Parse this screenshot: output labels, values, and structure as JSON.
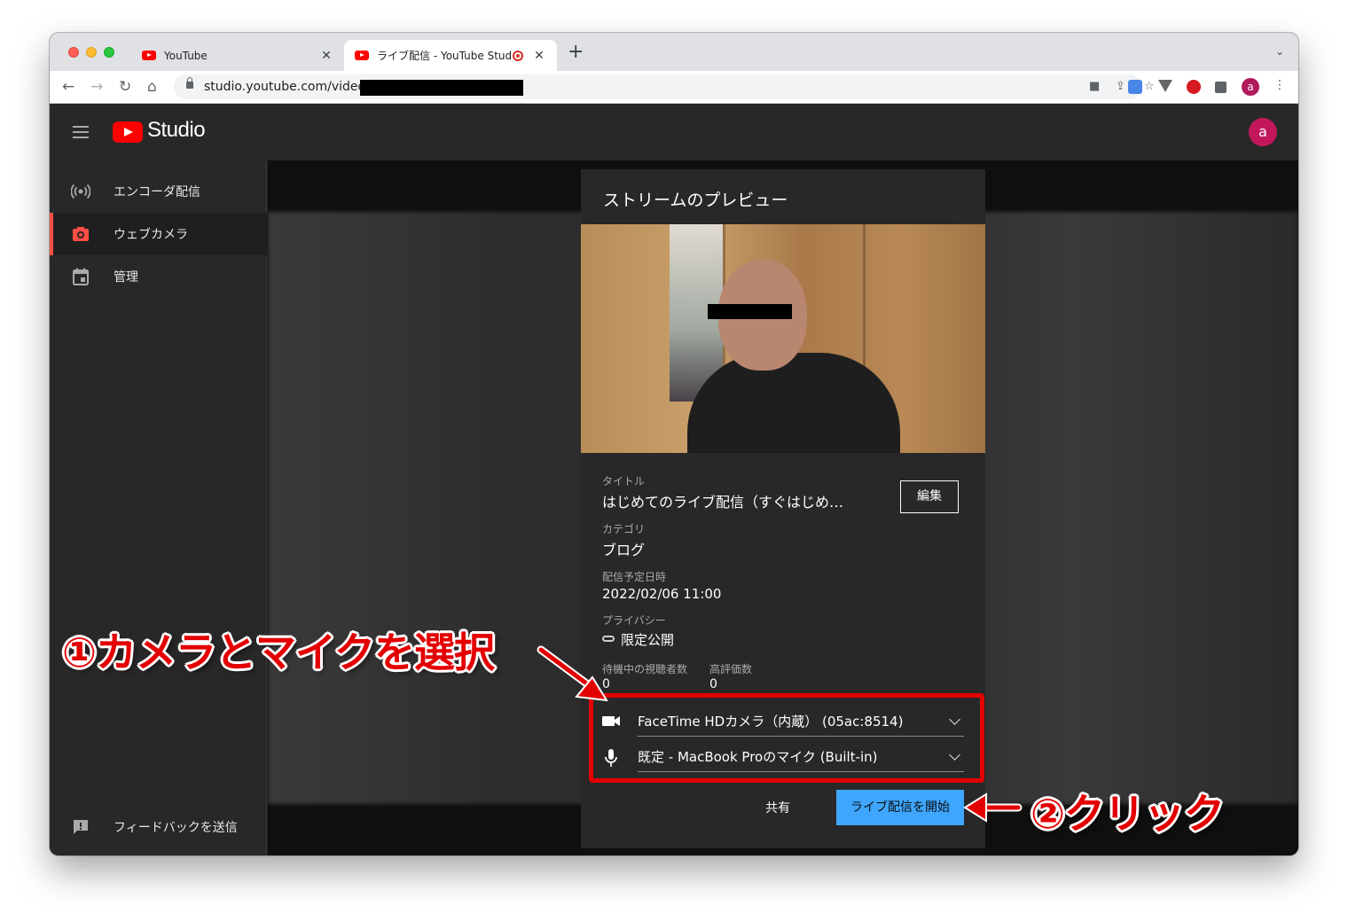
{
  "browser": {
    "tabs": [
      {
        "title": "YouTube",
        "active": false
      },
      {
        "title": "ライブ配信 - YouTube Studio",
        "active": true
      }
    ],
    "url": "studio.youtube.com/video/"
  },
  "studio": {
    "logo_text": "Studio",
    "avatar_letter": "a",
    "sidebar": {
      "items": [
        {
          "label": "エンコーダ配信",
          "icon": "broadcast-icon"
        },
        {
          "label": "ウェブカメラ",
          "icon": "camera-icon",
          "active": true
        },
        {
          "label": "管理",
          "icon": "calendar-icon"
        }
      ],
      "feedback_label": "フィードバックを送信"
    }
  },
  "dialog": {
    "title": "ストリームのプレビュー",
    "title_label": "タイトル",
    "title_value": "はじめてのライブ配信（すぐはじめ…",
    "edit_button": "編集",
    "category_label": "カテゴリ",
    "category_value": "ブログ",
    "schedule_label": "配信予定日時",
    "schedule_value": "2022/02/06 11:00",
    "privacy_label": "プライバシー",
    "privacy_value": "限定公開",
    "waiting_label": "待機中の視聴者数",
    "waiting_value": "0",
    "likes_label": "高評価数",
    "likes_value": "0",
    "camera_select": "FaceTime HDカメラ（内蔵） (05ac:8514)",
    "mic_select": "既定 - MacBook Proのマイク (Built-in)",
    "share_button": "共有",
    "start_button": "ライブ配信を開始"
  },
  "annotations": {
    "step1": "①カメラとマイクを選択",
    "step2": "②クリック",
    "color": "#e30000"
  }
}
